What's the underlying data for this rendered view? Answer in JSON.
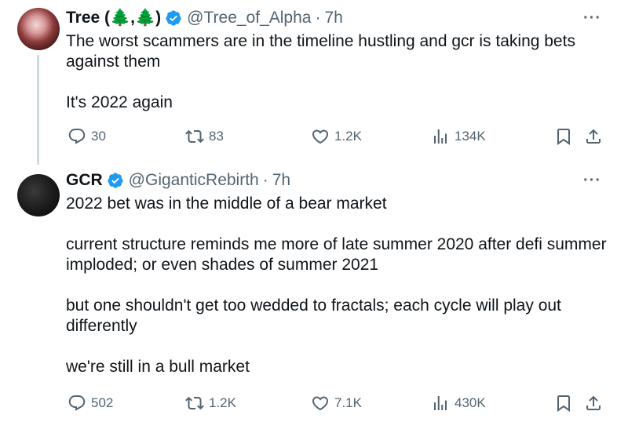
{
  "tweets": [
    {
      "name": "Tree (🌲,🌲)",
      "handle": "@Tree_of_Alpha",
      "dot": "·",
      "time": "7h",
      "paragraphs": [
        "The worst scammers are in the timeline hustling and gcr is taking bets against them",
        "It's 2022 again"
      ],
      "stats": {
        "replies": "30",
        "retweets": "83",
        "likes": "1.2K",
        "views": "134K"
      }
    },
    {
      "name": "GCR",
      "handle": "@GiganticRebirth",
      "dot": "·",
      "time": "7h",
      "paragraphs": [
        "2022 bet was in the middle of a bear market",
        "current structure reminds me more of late summer 2020 after defi summer imploded;  or even shades of summer 2021",
        "but one shouldn't get too wedded to fractals;  each cycle will play out differently",
        "we're still in a bull market"
      ],
      "stats": {
        "replies": "502",
        "retweets": "1.2K",
        "likes": "7.1K",
        "views": "430K"
      }
    }
  ],
  "more_label": "···",
  "colors": {
    "text": "#0f1419",
    "secondary": "#536471",
    "verified": "#1d9bf0",
    "thread_line": "#cfd9de"
  },
  "icons": [
    "verified-badge-icon",
    "reply-icon",
    "retweet-icon",
    "like-icon",
    "views-icon",
    "bookmark-icon",
    "share-icon",
    "more-icon"
  ]
}
